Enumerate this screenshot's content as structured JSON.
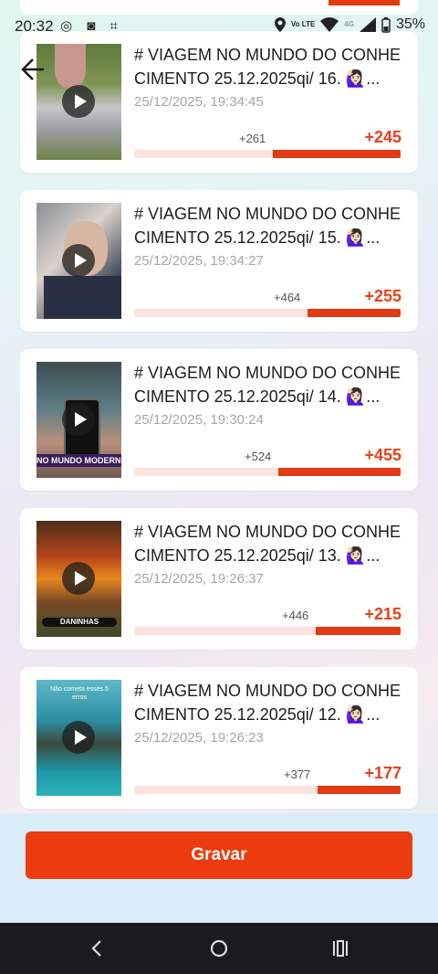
{
  "status_bar": {
    "time": "20:32",
    "apps": "◎ ◙ ⌗",
    "network": "Vo LTE",
    "signal_label": "4G",
    "battery": "35%"
  },
  "cards": [
    {
      "title": "# VIAGEM NO MUNDO DO CONHE CIMENTO 25.12.2025qi/ 16. 🙋🏻‍♀️...",
      "date": "25/12/2025, 19:34:45",
      "small_value": "+261",
      "big_value": "+245",
      "fill": 0.48
    },
    {
      "title": "# VIAGEM NO MUNDO DO CONHE CIMENTO 25.12.2025qi/ 15. 🙋🏻‍♀️...",
      "date": "25/12/2025, 19:34:27",
      "small_value": "+464",
      "big_value": "+255",
      "fill": 0.35
    },
    {
      "title": "# VIAGEM NO MUNDO DO CONHE CIMENTO 25.12.2025qi/ 14. 🙋🏻‍♀️...",
      "date": "25/12/2025, 19:30:24",
      "small_value": "+524",
      "big_value": "+455",
      "fill": 0.46,
      "thumb_caption": "NO MUNDO MODERNO"
    },
    {
      "title": "# VIAGEM NO MUNDO DO CONHE CIMENTO 25.12.2025qi/ 13. 🙋🏻‍♀️...",
      "date": "25/12/2025, 19:26:37",
      "small_value": "+446",
      "big_value": "+215",
      "fill": 0.32,
      "thumb_caption": "DANINHAS"
    },
    {
      "title": "# VIAGEM NO MUNDO DO CONHE CIMENTO 25.12.2025qi/ 12. 🙋🏻‍♀️...",
      "date": "25/12/2025, 19:26:23",
      "small_value": "+377",
      "big_value": "+177",
      "fill": 0.31,
      "thumb_caption": "Não cometa esses 5 erros"
    }
  ],
  "record_button": "Gravar",
  "colors": {
    "accent": "#ec3c0f",
    "bar_bg": "#fbe3df"
  }
}
